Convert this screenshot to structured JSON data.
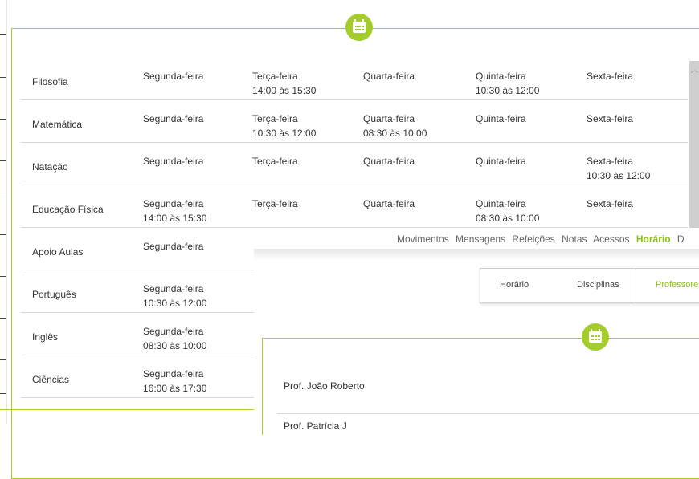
{
  "schedule": {
    "rows": [
      {
        "subject": "Filosofia",
        "cells": [
          [
            "Segunda-feira",
            ""
          ],
          [
            "Terça-feira",
            "14:00 às 15:30"
          ],
          [
            "Quarta-feira",
            ""
          ],
          [
            "Quinta-feira",
            "10:30 às 12:00"
          ],
          [
            "Sexta-feira",
            ""
          ]
        ]
      },
      {
        "subject": "Matemática",
        "cells": [
          [
            "Segunda-feira",
            ""
          ],
          [
            "Terça-feira",
            "10:30 às 12:00"
          ],
          [
            "Quarta-feira",
            "08:30 às 10:00"
          ],
          [
            "Quinta-feira",
            ""
          ],
          [
            "Sexta-feira",
            ""
          ]
        ]
      },
      {
        "subject": "Natação",
        "cells": [
          [
            "Segunda-feira",
            ""
          ],
          [
            "Terça-feira",
            ""
          ],
          [
            "Quarta-feira",
            ""
          ],
          [
            "Quinta-feira",
            ""
          ],
          [
            "Sexta-feira",
            "10:30 às 12:00"
          ]
        ]
      },
      {
        "subject": "Educação Física",
        "cells": [
          [
            "Segunda-feira",
            "14:00 às 15:30"
          ],
          [
            "Terça-feira",
            ""
          ],
          [
            "Quarta-feira",
            ""
          ],
          [
            "Quinta-feira",
            "08:30 às 10:00"
          ],
          [
            "Sexta-feira",
            ""
          ]
        ]
      },
      {
        "subject": "Apoio Aulas",
        "cells": [
          [
            "Segunda-feira",
            ""
          ]
        ]
      },
      {
        "subject": "Português",
        "cells": [
          [
            "Segunda-feira",
            "10:30 às 12:00"
          ]
        ]
      },
      {
        "subject": "Inglês",
        "cells": [
          [
            "Segunda-feira",
            "08:30 às 10:00"
          ]
        ]
      },
      {
        "subject": "Ciências",
        "cells": [
          [
            "Segunda-feira",
            "16:00 às 17:30"
          ]
        ]
      }
    ]
  },
  "nav": {
    "items": [
      "Movimentos",
      "Mensagens",
      "Refeições",
      "Notas",
      "Acessos",
      "Horário",
      "D"
    ],
    "active": "Horário"
  },
  "tabs": {
    "horario": "Horário",
    "disciplinas": "Disciplinas",
    "professores": "Professores"
  },
  "professors": [
    "Prof. João Roberto",
    "Prof. Patrícia J"
  ],
  "icons": {
    "calendar": "calendar-icon"
  },
  "colors": {
    "accent": "#a4cc2a",
    "active_text": "#8cbf1f"
  }
}
